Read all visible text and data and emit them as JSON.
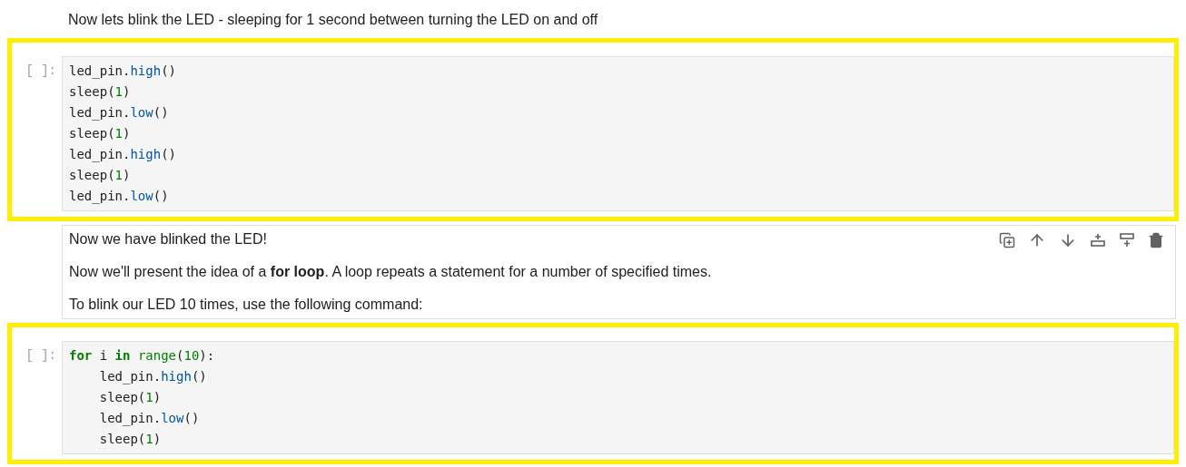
{
  "cells": [
    {
      "kind": "markdown",
      "selected": false,
      "paragraphs": [
        "Now lets blink the LED - sleeping for 1 second between turning the LED on and off"
      ]
    },
    {
      "kind": "code",
      "highlighted": true,
      "prompt": "[ ]:",
      "lines": [
        [
          {
            "text": "led_pin.",
            "kind": "plain"
          },
          {
            "text": "high",
            "kind": "method"
          },
          {
            "text": "()",
            "kind": "plain"
          }
        ],
        [
          {
            "text": "sleep(",
            "kind": "plain"
          },
          {
            "text": "1",
            "kind": "number"
          },
          {
            "text": ")",
            "kind": "plain"
          }
        ],
        [
          {
            "text": "led_pin.",
            "kind": "plain"
          },
          {
            "text": "low",
            "kind": "method"
          },
          {
            "text": "()",
            "kind": "plain"
          }
        ],
        [
          {
            "text": "sleep(",
            "kind": "plain"
          },
          {
            "text": "1",
            "kind": "number"
          },
          {
            "text": ")",
            "kind": "plain"
          }
        ],
        [
          {
            "text": "led_pin.",
            "kind": "plain"
          },
          {
            "text": "high",
            "kind": "method"
          },
          {
            "text": "()",
            "kind": "plain"
          }
        ],
        [
          {
            "text": "sleep(",
            "kind": "plain"
          },
          {
            "text": "1",
            "kind": "number"
          },
          {
            "text": ")",
            "kind": "plain"
          }
        ],
        [
          {
            "text": "led_pin.",
            "kind": "plain"
          },
          {
            "text": "low",
            "kind": "method"
          },
          {
            "text": "()",
            "kind": "plain"
          }
        ]
      ]
    },
    {
      "kind": "markdown",
      "selected": true,
      "paragraphs": [
        "Now we have blinked the LED!",
        "Now we'll present the idea of a **for loop**. A loop repeats a statement for a number of specified times.",
        "To blink our LED 10 times, use the following command:"
      ]
    },
    {
      "kind": "code",
      "highlighted": true,
      "prompt": "[ ]:",
      "lines": [
        [
          {
            "text": "for",
            "kind": "keyword"
          },
          {
            "text": " i ",
            "kind": "plain"
          },
          {
            "text": "in",
            "kind": "keyword"
          },
          {
            "text": " range",
            "kind": "builtin"
          },
          {
            "text": "(",
            "kind": "plain"
          },
          {
            "text": "10",
            "kind": "number"
          },
          {
            "text": "):",
            "kind": "plain"
          }
        ],
        [
          {
            "text": "    led_pin.",
            "kind": "plain"
          },
          {
            "text": "high",
            "kind": "method"
          },
          {
            "text": "()",
            "kind": "plain"
          }
        ],
        [
          {
            "text": "    sleep(",
            "kind": "plain"
          },
          {
            "text": "1",
            "kind": "number"
          },
          {
            "text": ")",
            "kind": "plain"
          }
        ],
        [
          {
            "text": "    led_pin.",
            "kind": "plain"
          },
          {
            "text": "low",
            "kind": "method"
          },
          {
            "text": "()",
            "kind": "plain"
          }
        ],
        [
          {
            "text": "    sleep(",
            "kind": "plain"
          },
          {
            "text": "1",
            "kind": "number"
          },
          {
            "text": ")",
            "kind": "plain"
          }
        ]
      ]
    }
  ]
}
